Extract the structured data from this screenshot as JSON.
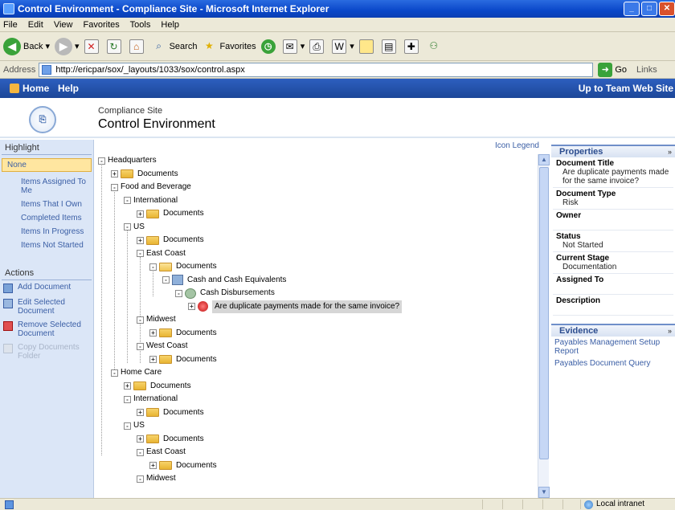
{
  "window": {
    "title": "Control Environment - Compliance Site - Microsoft Internet Explorer"
  },
  "menu": [
    "File",
    "Edit",
    "View",
    "Favorites",
    "Tools",
    "Help"
  ],
  "toolbar": {
    "back": "Back",
    "search": "Search",
    "favorites": "Favorites"
  },
  "address": {
    "label": "Address",
    "url": "http://ericpar/sox/_layouts/1033/sox/control.aspx",
    "go": "Go",
    "links": "Links"
  },
  "topnav": {
    "home": "Home",
    "help": "Help",
    "up": "Up to Team Web Site"
  },
  "header": {
    "site": "Compliance Site",
    "title": "Control Environment"
  },
  "leftnav": {
    "highlight_heading": "Highlight",
    "highlight_items": [
      "None",
      "Items Assigned To Me",
      "Items That I Own",
      "Completed Items",
      "Items In Progress",
      "Items Not Started"
    ],
    "actions_heading": "Actions",
    "actions": [
      {
        "label": "Add Document",
        "enabled": true
      },
      {
        "label": "Edit Selected Document",
        "enabled": true
      },
      {
        "label": "Remove Selected Document",
        "enabled": true
      },
      {
        "label": "Copy Documents Folder",
        "enabled": false
      }
    ]
  },
  "main": {
    "icon_legend": "Icon Legend",
    "tree": [
      {
        "label": "Headquarters",
        "level": 0,
        "type": "text",
        "pm": "-"
      },
      {
        "label": "Documents",
        "level": 1,
        "type": "folder",
        "pm": "+"
      },
      {
        "label": "Food and Beverage",
        "level": 1,
        "type": "text",
        "pm": "-"
      },
      {
        "label": "International",
        "level": 2,
        "type": "text",
        "pm": "-"
      },
      {
        "label": "Documents",
        "level": 3,
        "type": "folder",
        "pm": "+"
      },
      {
        "label": "US",
        "level": 2,
        "type": "text",
        "pm": "-"
      },
      {
        "label": "Documents",
        "level": 3,
        "type": "folder",
        "pm": "+"
      },
      {
        "label": "East Coast",
        "level": 3,
        "type": "text",
        "pm": "-"
      },
      {
        "label": "Documents",
        "level": 4,
        "type": "folder-open",
        "pm": "-"
      },
      {
        "label": "Cash and Cash Equivalents",
        "level": 5,
        "type": "category",
        "pm": "-"
      },
      {
        "label": "Cash Disbursements",
        "level": 6,
        "type": "gear",
        "pm": "-"
      },
      {
        "label": "Are duplicate payments made for the same invoice?",
        "level": 7,
        "type": "risk",
        "pm": "+",
        "selected": true
      },
      {
        "label": "Midwest",
        "level": 3,
        "type": "text",
        "pm": "-"
      },
      {
        "label": "Documents",
        "level": 4,
        "type": "folder",
        "pm": "+"
      },
      {
        "label": "West Coast",
        "level": 3,
        "type": "text",
        "pm": "-"
      },
      {
        "label": "Documents",
        "level": 4,
        "type": "folder",
        "pm": "+"
      },
      {
        "label": "Home Care",
        "level": 1,
        "type": "text",
        "pm": "-"
      },
      {
        "label": "Documents",
        "level": 2,
        "type": "folder",
        "pm": "+"
      },
      {
        "label": "International",
        "level": 2,
        "type": "text",
        "pm": "-"
      },
      {
        "label": "Documents",
        "level": 3,
        "type": "folder",
        "pm": "+"
      },
      {
        "label": "US",
        "level": 2,
        "type": "text",
        "pm": "-"
      },
      {
        "label": "Documents",
        "level": 3,
        "type": "folder",
        "pm": "+"
      },
      {
        "label": "East Coast",
        "level": 3,
        "type": "text",
        "pm": "-"
      },
      {
        "label": "Documents",
        "level": 4,
        "type": "folder",
        "pm": "+"
      },
      {
        "label": "Midwest",
        "level": 3,
        "type": "text",
        "pm": "-"
      }
    ]
  },
  "properties": {
    "heading": "Properties",
    "fields": [
      {
        "label": "Document Title",
        "value": "Are duplicate payments made for the same invoice?"
      },
      {
        "label": "Document Type",
        "value": "Risk"
      },
      {
        "label": "Owner",
        "value": ""
      },
      {
        "label": "Status",
        "value": "Not Started"
      },
      {
        "label": "Current Stage",
        "value": "Documentation"
      },
      {
        "label": "Assigned To",
        "value": ""
      },
      {
        "label": "Description",
        "value": ""
      }
    ]
  },
  "evidence": {
    "heading": "Evidence",
    "links": [
      "Payables Management Setup Report",
      "Payables Document Query"
    ]
  },
  "status": {
    "zone": "Local intranet"
  }
}
